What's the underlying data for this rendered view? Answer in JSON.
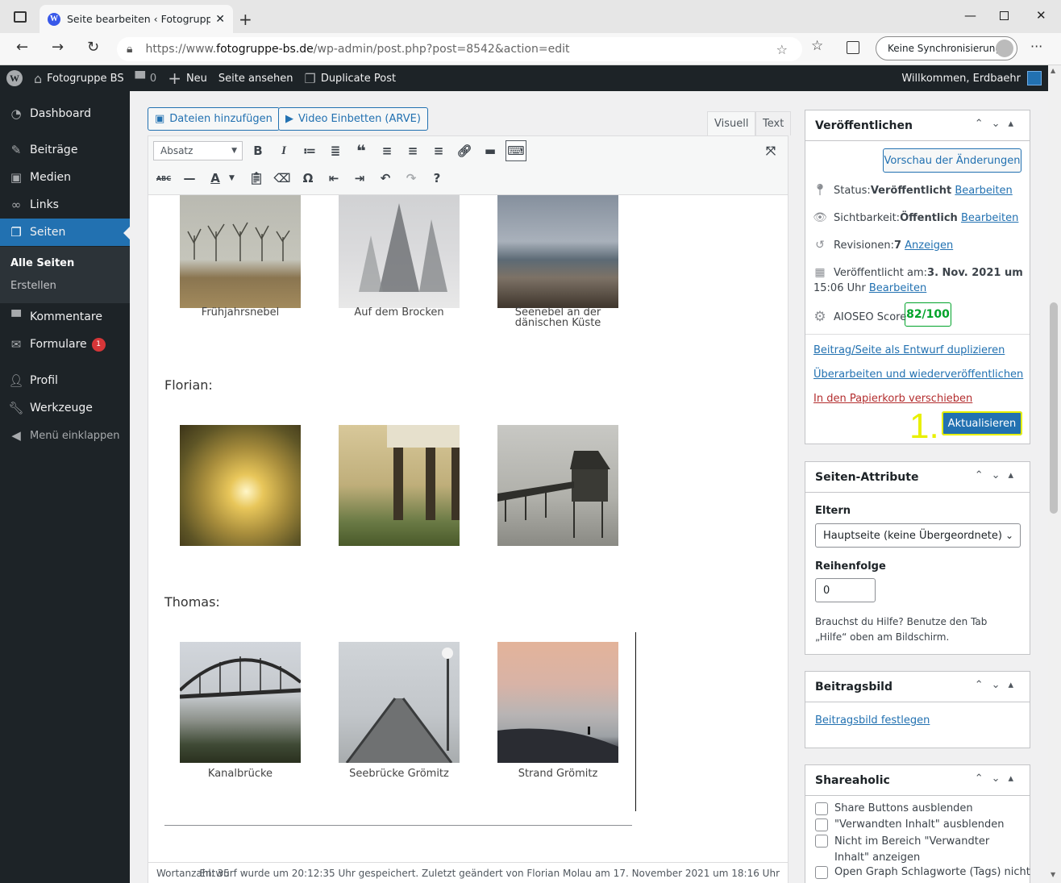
{
  "browser": {
    "tab_title": "Seite bearbeiten ‹ Fotogruppe BS",
    "url_prefix": "https://www.",
    "url_domain": "fotogruppe-bs.de",
    "url_path": "/wp-admin/post.php?post=8542&action=edit",
    "sync_label": "Keine Synchronisierung"
  },
  "adminbar": {
    "site": "Fotogruppe BS",
    "comments": "0",
    "new": "Neu",
    "view": "Seite ansehen",
    "duplicate": "Duplicate Post",
    "welcome": "Willkommen, Erdbaehr"
  },
  "sidebar": {
    "dashboard": "Dashboard",
    "posts": "Beiträge",
    "media": "Medien",
    "links": "Links",
    "pages": "Seiten",
    "all_pages": "Alle Seiten",
    "create": "Erstellen",
    "comments": "Kommentare",
    "forms": "Formulare",
    "forms_badge": "1",
    "profile": "Profil",
    "tools": "Werkzeuge",
    "collapse": "Menü einklappen"
  },
  "editor": {
    "add_media": "Dateien hinzufügen",
    "embed_video": "Video Einbetten (ARVE)",
    "tab_visual": "Visuell",
    "tab_text": "Text",
    "format": "Absatz",
    "captions_row1": [
      "Frühjahrsnebel",
      "Auf dem Brocken",
      "Seenebel an der dänischen Küste"
    ],
    "name_florian": "Florian:",
    "name_thomas": "Thomas:",
    "captions_row3": [
      "Kanalbrücke",
      "Seebrücke Grömitz",
      "Strand Grömitz"
    ],
    "word_count": "Wortanzahl: 35",
    "status_text": "Entwurf wurde um 20:12:35 Uhr gespeichert. Zuletzt geändert von Florian Molau am 17. November 2021 um 18:16 Uhr"
  },
  "publish": {
    "title": "Veröffentlichen",
    "preview": "Vorschau der Änderungen",
    "status_label": "Status: ",
    "status_value": "Veröffentlicht",
    "visibility_label": "Sichtbarkeit: ",
    "visibility_value": "Öffentlich",
    "revisions_label": "Revisionen: ",
    "revisions_value": "7",
    "show": "Anzeigen",
    "published_label": "Veröffentlicht am: ",
    "published_date": "3. Nov. 2021 um",
    "published_time": "15:06 Uhr",
    "edit": "Bearbeiten",
    "aioseo_label": "AIOSEO Score",
    "aioseo_score": "82/100",
    "duplicate_draft": "Beitrag/Seite als Entwurf duplizieren",
    "rewrite": "Überarbeiten und wiederveröffentlichen",
    "trash": "In den Papierkorb verschieben",
    "update": "Aktualisieren",
    "annotation": "1."
  },
  "attributes": {
    "title": "Seiten-Attribute",
    "parent_label": "Eltern",
    "parent_value": "Hauptseite (keine Übergeordnete)",
    "order_label": "Reihenfolge",
    "order_value": "0",
    "help": "Brauchst du Hilfe? Benutze den Tab „Hilfe“ oben am Bildschirm."
  },
  "featured": {
    "title": "Beitragsbild",
    "set": "Beitragsbild festlegen"
  },
  "shareaholic": {
    "title": "Shareaholic",
    "opt1": "Share Buttons ausblenden",
    "opt2": "\"Verwandten Inhalt\" ausblenden",
    "opt3": "Nicht im Bereich \"Verwandter Inhalt\" anzeigen",
    "opt4": "Open Graph Schlagworte (Tags) nicht"
  }
}
